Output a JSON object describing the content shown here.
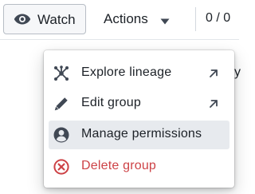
{
  "toolbar": {
    "watch": {
      "label": "Watch",
      "icon": "eye-icon"
    },
    "actions": {
      "label": "Actions",
      "icon": "caret-down-icon"
    },
    "counter": "0 / 0",
    "peek_text": "y"
  },
  "menu": {
    "items": [
      {
        "label": "Explore lineage",
        "icon": "lineage-icon",
        "trailing_icon": "arrow-top-right-icon",
        "active": false,
        "intent": "default"
      },
      {
        "label": "Edit group",
        "icon": "pencil-icon",
        "trailing_icon": "arrow-top-right-icon",
        "active": false,
        "intent": "default"
      },
      {
        "label": "Manage permissions",
        "icon": "user-icon",
        "active": true,
        "intent": "default"
      },
      {
        "label": "Delete group",
        "icon": "delete-icon",
        "active": false,
        "intent": "danger"
      }
    ]
  },
  "colors": {
    "text": "#1c2127",
    "icon": "#404854",
    "danger": "#cd4246",
    "active_bg": "#e7eaee",
    "border": "#b7bdc5"
  }
}
